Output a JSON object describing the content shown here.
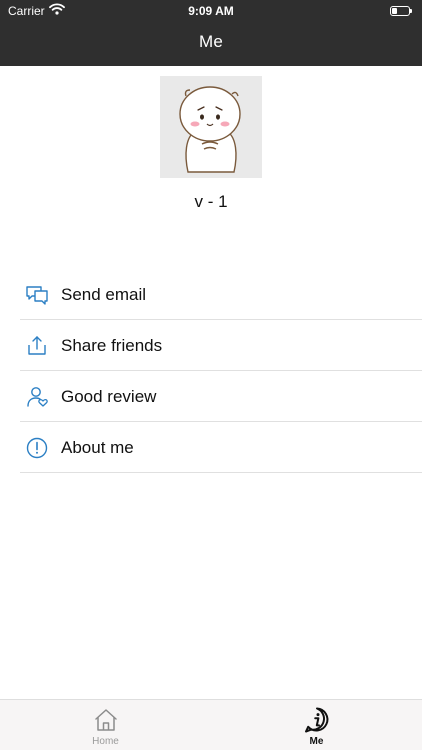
{
  "status_bar": {
    "carrier": "Carrier",
    "time": "9:09 AM",
    "wifi_icon": "wifi-icon",
    "battery_icon": "battery-icon"
  },
  "nav": {
    "title": "Me"
  },
  "profile": {
    "avatar_icon": "cartoon-avatar",
    "version": "v - 1"
  },
  "menu": {
    "items": [
      {
        "label": "Send email",
        "icon": "chat-bubbles-icon"
      },
      {
        "label": "Share friends",
        "icon": "share-upload-icon"
      },
      {
        "label": "Good review",
        "icon": "user-heart-icon"
      },
      {
        "label": "About me",
        "icon": "info-circle-icon"
      }
    ]
  },
  "tabbar": {
    "tabs": [
      {
        "label": "Home",
        "icon": "home-icon",
        "selected": false
      },
      {
        "label": "Me",
        "icon": "info-bubble-icon",
        "selected": true
      }
    ]
  },
  "colors": {
    "nav_background": "#2f2f2f",
    "icon_accent": "#2b7fc4",
    "tabbar_background": "#f7f5f5"
  }
}
